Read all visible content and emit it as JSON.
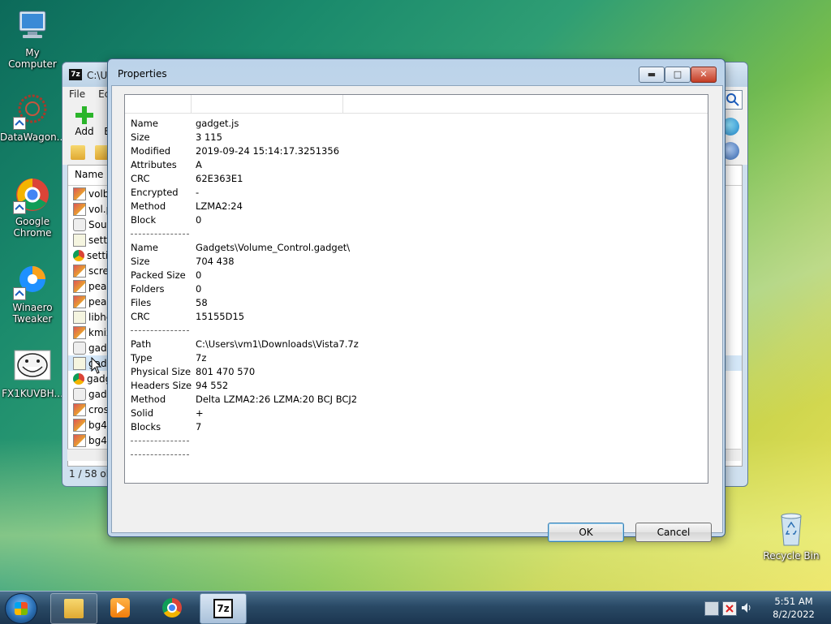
{
  "desktop": {
    "icons": [
      {
        "label": "My Computer"
      },
      {
        "label": "DataWagon..."
      },
      {
        "label": "Google Chrome"
      },
      {
        "label": "Winaero Tweaker"
      },
      {
        "label": "FX1KUVBH..."
      },
      {
        "label": "Recycle Bin"
      }
    ]
  },
  "bg_window": {
    "title": "C:\\Us",
    "menu": [
      "File",
      "Ec"
    ],
    "toolbar": {
      "add_label": "Add",
      "next_label": "E"
    },
    "list_header": "Name",
    "rows": [
      "volba",
      "vol.p",
      "Sour",
      "settir",
      "settir",
      "scree",
      "peak",
      "peak",
      "libhe",
      "kmix",
      "gadg",
      "gadg",
      "gadg",
      "gadg",
      "cross",
      "bg42",
      "bg41"
    ],
    "status": "1 / 58 obj"
  },
  "dialog": {
    "title": "Properties",
    "properties": [
      {
        "key": "Name",
        "value": "gadget.js"
      },
      {
        "key": "Size",
        "value": "3 115"
      },
      {
        "key": "Modified",
        "value": "2019-09-24 15:14:17.3251356"
      },
      {
        "key": "Attributes",
        "value": "A"
      },
      {
        "key": "CRC",
        "value": "62E363E1"
      },
      {
        "key": "Encrypted",
        "value": "-"
      },
      {
        "key": "Method",
        "value": "LZMA2:24"
      },
      {
        "key": "Block",
        "value": "0"
      },
      {
        "separator": true
      },
      {
        "key": "Name",
        "value": "Gadgets\\Volume_Control.gadget\\"
      },
      {
        "key": "Size",
        "value": "704 438"
      },
      {
        "key": "Packed Size",
        "value": "0"
      },
      {
        "key": "Folders",
        "value": "0"
      },
      {
        "key": "Files",
        "value": "58"
      },
      {
        "key": "CRC",
        "value": "15155D15"
      },
      {
        "separator": true
      },
      {
        "key": "Path",
        "value": "C:\\Users\\vm1\\Downloads\\Vista7.7z"
      },
      {
        "key": "Type",
        "value": "7z"
      },
      {
        "key": "Physical Size",
        "value": "801 470 570"
      },
      {
        "key": "Headers Size",
        "value": "94 552"
      },
      {
        "key": "Method",
        "value": "Delta LZMA2:26 LZMA:20 BCJ BCJ2"
      },
      {
        "key": "Solid",
        "value": "+"
      },
      {
        "key": "Blocks",
        "value": "7"
      },
      {
        "separator": true
      },
      {
        "separator": true
      }
    ],
    "ok_label": "OK",
    "cancel_label": "Cancel"
  },
  "taskbar": {
    "time": "5:51 AM",
    "date": "8/2/2022",
    "zip_icon_text": "7z"
  }
}
